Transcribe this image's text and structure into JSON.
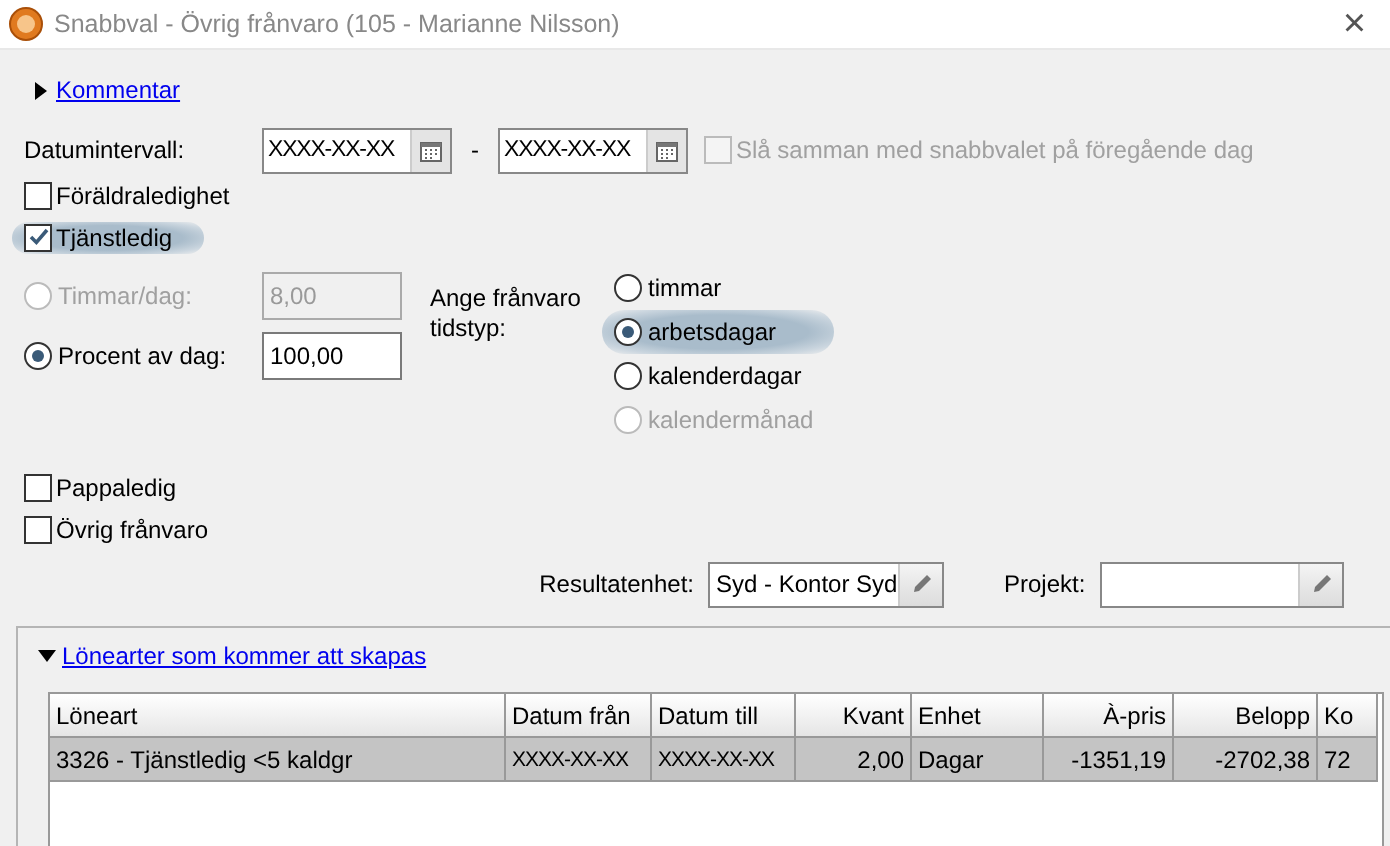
{
  "window": {
    "title": "Snabbval - Övrig frånvaro (105 - Marianne Nilsson)",
    "close": "×"
  },
  "comment_link": {
    "label": "Kommentar",
    "expanded": false
  },
  "date_range": {
    "label": "Datumintervall:",
    "from": "XXXX-XX-XX",
    "separator": "-",
    "to": "XXXX-XX-XX",
    "merge": {
      "label": "Slå samman med snabbvalet på föregående dag",
      "checked": false,
      "disabled": true
    }
  },
  "absence_checks_top": [
    {
      "label": "Föräldraledighet",
      "checked": false,
      "highlighted": false
    },
    {
      "label": "Tjänstledig",
      "checked": true,
      "highlighted": true
    }
  ],
  "amount_modes": [
    {
      "label": "Timmar/dag:",
      "value": "8,00",
      "selected": false,
      "disabled": true
    },
    {
      "label": "Procent av dag:",
      "value": "100,00",
      "selected": true,
      "disabled": false
    }
  ],
  "time_type": {
    "label": "Ange frånvaro tidstyp:",
    "options": [
      {
        "label": "timmar",
        "selected": false,
        "disabled": false,
        "highlighted": false
      },
      {
        "label": "arbetsdagar",
        "selected": true,
        "disabled": false,
        "highlighted": true
      },
      {
        "label": "kalenderdagar",
        "selected": false,
        "disabled": false,
        "highlighted": false
      },
      {
        "label": "kalendermånad",
        "selected": false,
        "disabled": true,
        "highlighted": false
      }
    ]
  },
  "absence_checks_bottom": [
    {
      "label": "Pappaledig",
      "checked": false,
      "highlighted": false
    },
    {
      "label": "Övrig frånvaro",
      "checked": false,
      "highlighted": false
    }
  ],
  "result_unit": {
    "label": "Resultatenhet:",
    "value": "Syd - Kontor Syd"
  },
  "project": {
    "label": "Projekt:"
  },
  "wage_types": {
    "title": "Lönearter som kommer att skapas",
    "expanded": true,
    "table": {
      "columns": [
        {
          "label": "Löneart"
        },
        {
          "label": "Datum från"
        },
        {
          "label": "Datum till"
        },
        {
          "label": "Kvant"
        },
        {
          "label": "Enhet"
        },
        {
          "label": "À-pris"
        },
        {
          "label": "Belopp"
        },
        {
          "label": "Ko"
        }
      ],
      "rows": [
        {
          "selected": true,
          "cells": [
            "3326 - Tjänstledig <5 kaldgr",
            "XXXX-XX-XX",
            "XXXX-XX-XX",
            "2,00",
            "Dagar",
            "-1351,19",
            "-2702,38",
            "72"
          ]
        }
      ]
    }
  }
}
